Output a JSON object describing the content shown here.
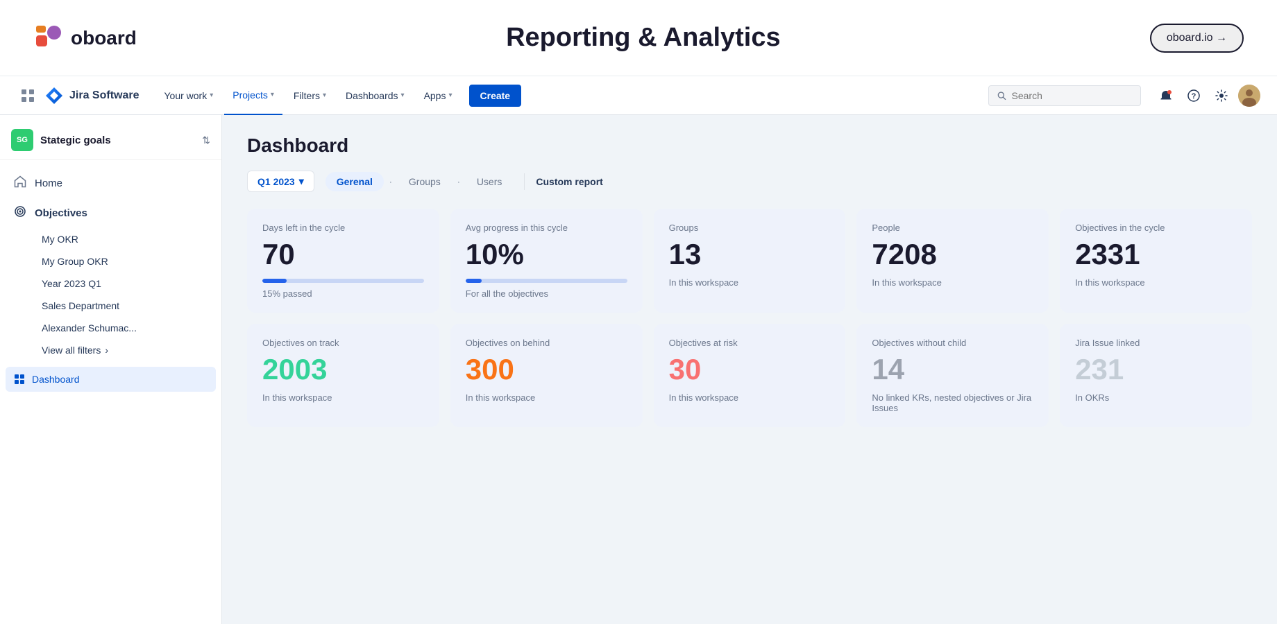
{
  "topBanner": {
    "logoText": "oboard",
    "title": "Reporting & Analytics",
    "oboardLink": "oboard.io →"
  },
  "jiraNav": {
    "appName": "Jira Software",
    "navItems": [
      {
        "label": "Your work",
        "hasDropdown": true,
        "active": false
      },
      {
        "label": "Projects",
        "hasDropdown": true,
        "active": true
      },
      {
        "label": "Filters",
        "hasDropdown": true,
        "active": false
      },
      {
        "label": "Dashboards",
        "hasDropdown": true,
        "active": false
      },
      {
        "label": "Apps",
        "hasDropdown": true,
        "active": false
      }
    ],
    "createLabel": "Create",
    "searchPlaceholder": "Search"
  },
  "sidebar": {
    "workspace": {
      "badge": "SG",
      "name": "Stategic goals"
    },
    "homeLabel": "Home",
    "objectivesLabel": "Objectives",
    "subItems": [
      "My OKR",
      "My Group OKR",
      "Year 2023 Q1",
      "Sales Department",
      "Alexander Schumac..."
    ],
    "viewAllLabel": "View all filters",
    "dashboardLabel": "Dashboard"
  },
  "dashboard": {
    "title": "Dashboard",
    "cycleSelector": "Q1 2023",
    "tabs": [
      {
        "label": "Gerenal",
        "active": true
      },
      {
        "label": "Groups",
        "active": false
      },
      {
        "label": "Users",
        "active": false
      }
    ],
    "customReportLabel": "Custom report",
    "statsRow1": [
      {
        "label": "Days left in the cycle",
        "value": "70",
        "sub": "15% passed",
        "hasProgress": true,
        "progressFill": 15,
        "fillColor": "fill-blue"
      },
      {
        "label": "Avg progress in this cycle",
        "value": "10%",
        "sub": "For all the objectives",
        "hasProgress": true,
        "progressFill": 10,
        "fillColor": "fill-blue"
      },
      {
        "label": "Groups",
        "value": "13",
        "sub": "In this workspace",
        "hasProgress": false,
        "fillColor": ""
      },
      {
        "label": "People",
        "value": "7208",
        "sub": "In this workspace",
        "hasProgress": false,
        "fillColor": ""
      },
      {
        "label": "Objectives in the cycle",
        "value": "2331",
        "sub": "In this workspace",
        "hasProgress": false,
        "fillColor": ""
      }
    ],
    "statsRow2": [
      {
        "label": "Objectives on track",
        "value": "2003",
        "sub": "In this workspace",
        "valueColor": "stat-value-green"
      },
      {
        "label": "Objectives on behind",
        "value": "300",
        "sub": "In this workspace",
        "valueColor": "stat-value-orange"
      },
      {
        "label": "Objectives at risk",
        "value": "30",
        "sub": "In this workspace",
        "valueColor": "stat-value-red"
      },
      {
        "label": "Objectives without child",
        "value": "14",
        "sub": "No linked KRs, nested objectives or Jira Issues",
        "valueColor": "stat-value-darkgray"
      },
      {
        "label": "Jira Issue linked",
        "value": "231",
        "sub": "In OKRs",
        "valueColor": "stat-value-lightgray"
      }
    ]
  }
}
